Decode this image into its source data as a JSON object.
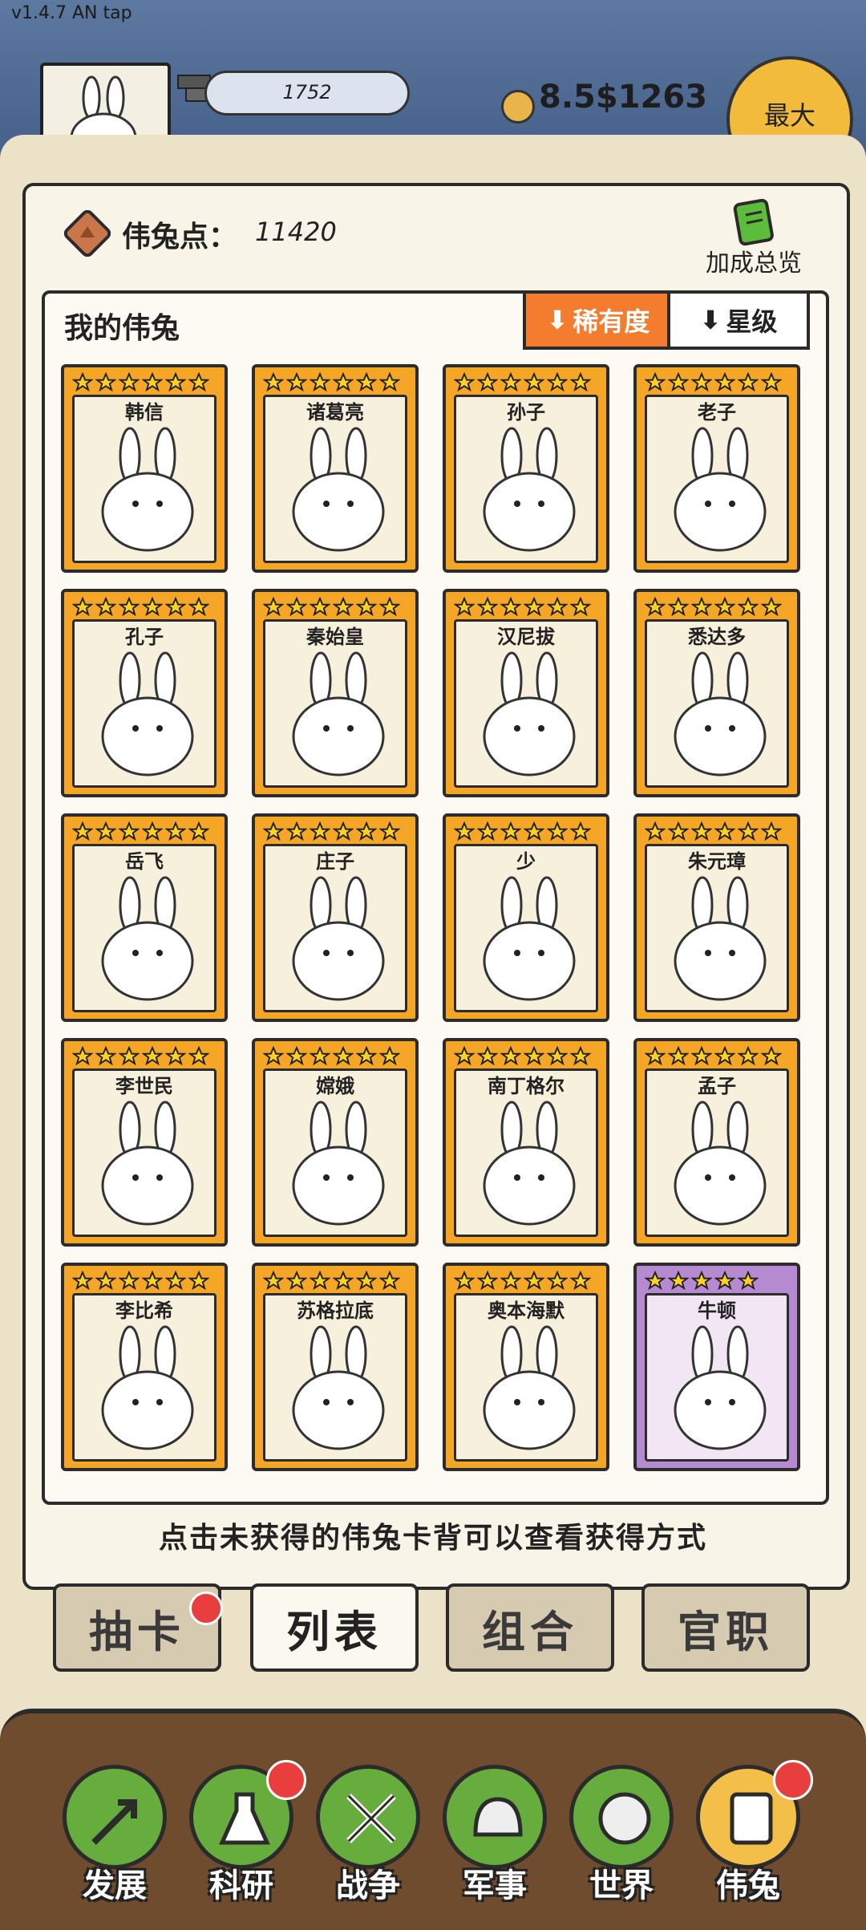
{
  "version": "v1.4.7 AN tap",
  "top": {
    "resource_value": "1752",
    "money_value": "8.5$1263",
    "max_label": "最大"
  },
  "points": {
    "label": "伟兔点：",
    "value": "11420"
  },
  "bonus_label": "加成总览",
  "list_title": "我的伟兔",
  "sort": {
    "rarity_label": "稀有度",
    "star_label": "星级"
  },
  "cards": [
    {
      "name": "韩信",
      "stars": 6,
      "rarity": "gold"
    },
    {
      "name": "诸葛亮",
      "stars": 6,
      "rarity": "gold"
    },
    {
      "name": "孙子",
      "stars": 6,
      "rarity": "gold"
    },
    {
      "name": "老子",
      "stars": 6,
      "rarity": "gold"
    },
    {
      "name": "孔子",
      "stars": 6,
      "rarity": "gold"
    },
    {
      "name": "秦始皇",
      "stars": 6,
      "rarity": "gold"
    },
    {
      "name": "汉尼拔",
      "stars": 6,
      "rarity": "gold"
    },
    {
      "name": "悉达多",
      "stars": 6,
      "rarity": "gold"
    },
    {
      "name": "岳飞",
      "stars": 6,
      "rarity": "gold"
    },
    {
      "name": "庄子",
      "stars": 6,
      "rarity": "gold"
    },
    {
      "name": "少",
      "stars": 6,
      "rarity": "gold"
    },
    {
      "name": "朱元璋",
      "stars": 6,
      "rarity": "gold"
    },
    {
      "name": "李世民",
      "stars": 6,
      "rarity": "gold"
    },
    {
      "name": "嫦娥",
      "stars": 6,
      "rarity": "gold"
    },
    {
      "name": "南丁格尔",
      "stars": 6,
      "rarity": "gold"
    },
    {
      "name": "孟子",
      "stars": 6,
      "rarity": "gold"
    },
    {
      "name": "李比希",
      "stars": 6,
      "rarity": "gold"
    },
    {
      "name": "苏格拉底",
      "stars": 6,
      "rarity": "gold"
    },
    {
      "name": "奥本海默",
      "stars": 6,
      "rarity": "gold"
    },
    {
      "name": "牛顿",
      "stars": 5,
      "rarity": "purple"
    }
  ],
  "hint": "点击未获得的伟兔卡背可以查看获得方式",
  "tabs": [
    {
      "label": "抽卡",
      "active": false,
      "badge": true
    },
    {
      "label": "列表",
      "active": true,
      "badge": false
    },
    {
      "label": "组合",
      "active": false,
      "badge": false
    },
    {
      "label": "官职",
      "active": false,
      "badge": false
    }
  ],
  "nav": [
    {
      "label": "发展",
      "icon": "growth-arrow-icon",
      "badge": false,
      "active": false
    },
    {
      "label": "科研",
      "icon": "flask-icon",
      "badge": true,
      "active": false
    },
    {
      "label": "战争",
      "icon": "crossed-swords-icon",
      "badge": false,
      "active": false
    },
    {
      "label": "军事",
      "icon": "helmet-icon",
      "badge": false,
      "active": false
    },
    {
      "label": "世界",
      "icon": "globe-icon",
      "badge": false,
      "active": false
    },
    {
      "label": "伟兔",
      "icon": "bunny-card-icon",
      "badge": true,
      "active": true
    }
  ]
}
